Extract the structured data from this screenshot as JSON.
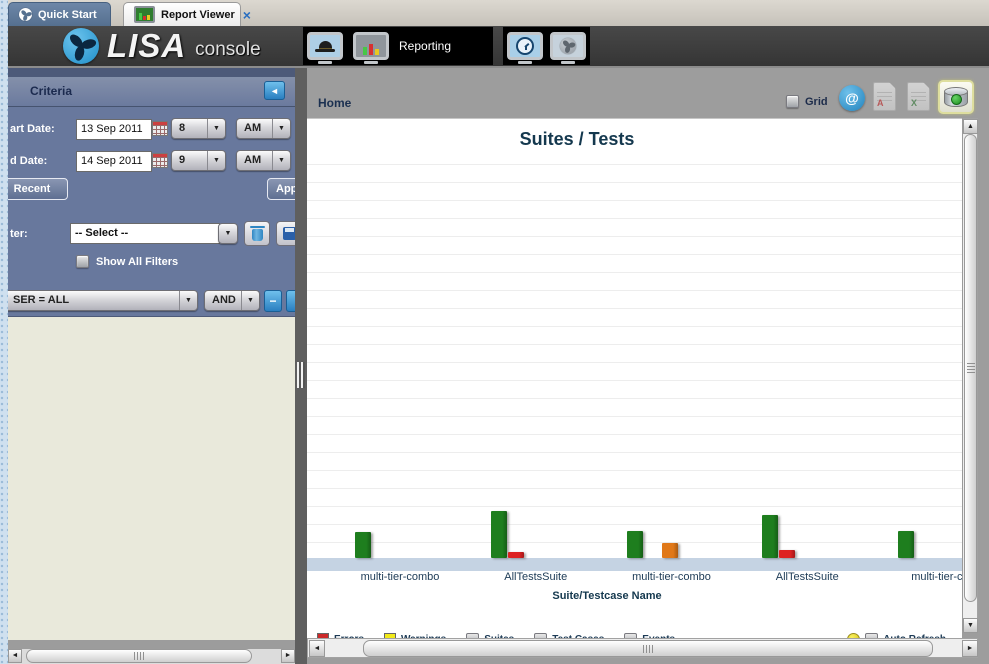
{
  "tab_bar": {
    "tabs": [
      {
        "label": "Quick Start"
      },
      {
        "label": "Report Viewer"
      }
    ]
  },
  "header": {
    "logo_main": "LISA",
    "logo_sub": "console",
    "nav_label": "Reporting"
  },
  "criteria": {
    "title": "Criteria",
    "start_label": "art Date:",
    "start_value": "13 Sep 2011",
    "start_hour": "8",
    "start_meridiem": "AM",
    "end_label": "d Date:",
    "end_value": "14 Sep 2011",
    "end_hour": "9",
    "end_meridiem": "AM",
    "recent_button": "Recent",
    "apply_button": "Appl",
    "filter_label": "ter:",
    "filter_value": "-- Select --",
    "show_all_filters": "Show All Filters",
    "user_clause": "SER = ALL",
    "operator": "AND"
  },
  "report": {
    "breadcrumb": "Home",
    "grid_label": "Grid"
  },
  "chart_data": {
    "type": "bar",
    "title": "Suites / Tests",
    "xlabel": "Suite/Testcase Name",
    "ylabel": "",
    "categories": [
      "multi-tier-combo",
      "AllTestsSuite",
      "multi-tier-combo",
      "AllTestsSuite",
      "multi-tier-con"
    ],
    "series": [
      {
        "name": "green",
        "color": "#1e7e1e",
        "values": [
          1.45,
          2.6,
          1.5,
          2.4,
          1.5
        ]
      },
      {
        "name": "red",
        "color": "#dd2222",
        "values": [
          0,
          0.33,
          0,
          0.44,
          0
        ]
      },
      {
        "name": "orange",
        "color": "#e07818",
        "values": [
          0,
          0,
          0.83,
          0,
          0
        ]
      }
    ],
    "ylim": [
      0,
      22
    ],
    "grid": true,
    "note": "no y-axis tick labels visible; values estimated in gridline units"
  },
  "legend": {
    "items": [
      {
        "type": "swatch",
        "color": "#cc2a2a",
        "label": "Errors"
      },
      {
        "type": "swatch",
        "color": "#f2ea1a",
        "label": "Warnings"
      },
      {
        "type": "checkbox",
        "label": "Suites"
      },
      {
        "type": "checkbox",
        "label": "Test Cases"
      },
      {
        "type": "checkbox",
        "label": "Events"
      }
    ],
    "auto_refresh_label": "Auto Refresh"
  },
  "icons": {
    "dropdown_arrow": "▼",
    "collapse_left": "◄",
    "scroll_left": "◄",
    "scroll_right": "►",
    "scroll_up": "▲",
    "scroll_down": "▼",
    "close": "×",
    "at": "@",
    "minus": "−",
    "pdf_mark": "A",
    "excel_mark": "X"
  }
}
